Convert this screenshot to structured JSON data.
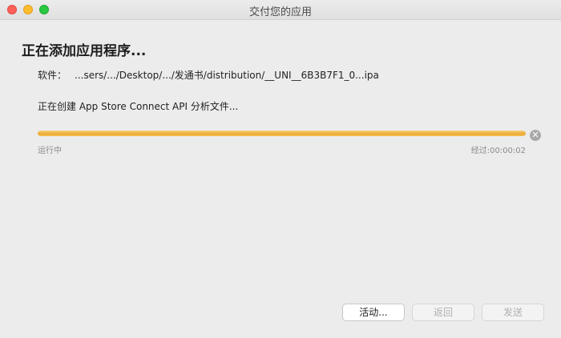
{
  "window": {
    "title": "交付您的应用"
  },
  "dialog": {
    "heading": "正在添加应用程序...",
    "software_label": "软件：",
    "software_path": "...sers/.../Desktop/.../发通书/distribution/__UNI__6B3B7F1_0...ipa",
    "status_text": "正在创建 App Store Connect API 分析文件...",
    "progress_fraction": 1.0,
    "state_label": "运行中",
    "elapsed": "经过:00:00:02"
  },
  "buttons": {
    "activity": "活动...",
    "back": "返回",
    "send": "发送"
  },
  "colors": {
    "progress_fill": "#eaa92f",
    "close": "#fc5f57",
    "minimize": "#fdbc2e",
    "maximize": "#28c840"
  }
}
